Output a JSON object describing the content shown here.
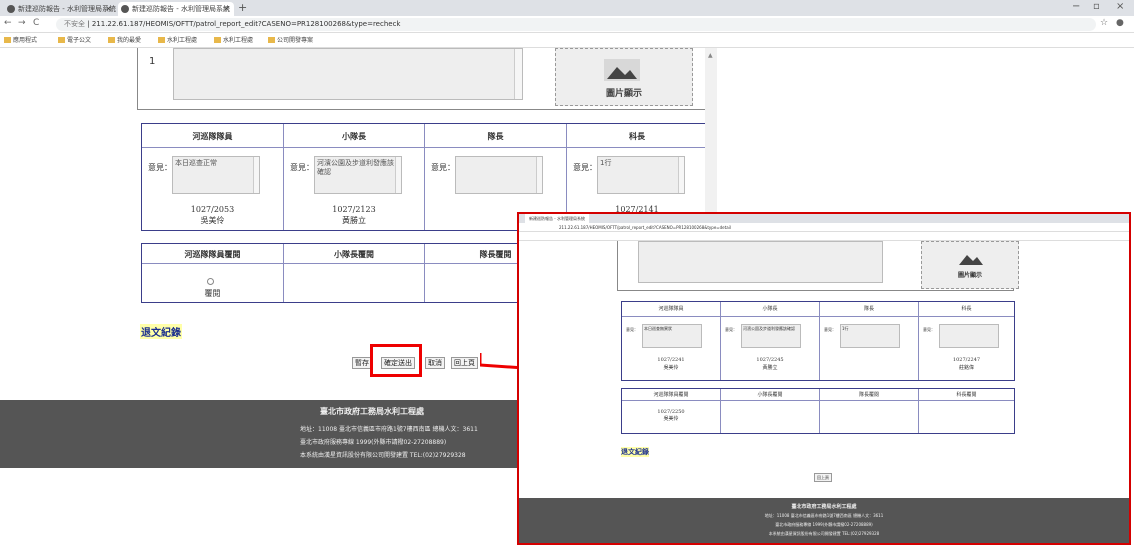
{
  "browser": {
    "tabs": [
      {
        "label": "新建巡防報告 - 水利管理局系統"
      },
      {
        "label": "新建巡防報告 - 水利管理局系統"
      }
    ],
    "new_tab": "+",
    "minimize": "−",
    "maximize": "▫",
    "close": "×",
    "security": "不安全",
    "url": "211.22.61.187/HEOMIS/OFTT/patrol_report_edit?CASENO=PR128100268&type=recheck",
    "bookmarks": [
      {
        "label": "應用程式"
      },
      {
        "label": "電子公文"
      },
      {
        "label": "我的最愛"
      },
      {
        "label": "水利工程處"
      },
      {
        "label": "水利工程處"
      },
      {
        "label": "公司開發專案"
      }
    ]
  },
  "report": {
    "row_number": "1",
    "image_label": "圖片顯示",
    "sign_table": {
      "columns": [
        {
          "header": "河巡隊隊員",
          "opinion_label": "意見：",
          "opinion": "本日巡查正常",
          "date": "1027/2053",
          "name": "吳美伶"
        },
        {
          "header": "小隊長",
          "opinion_label": "意見：",
          "opinion": "河濱公園及步道利發應該確認",
          "date": "1027/2123",
          "name": "黃勝立"
        },
        {
          "header": "隊長",
          "opinion_label": "意見：",
          "opinion": "",
          "date": "",
          "name": ""
        },
        {
          "header": "科長",
          "opinion_label": "意見：",
          "opinion": "1行",
          "date": "1027/2141",
          "name": ""
        }
      ]
    },
    "review_table": {
      "columns": [
        {
          "header": "河巡隊隊員覆閱",
          "label": "覆閱"
        },
        {
          "header": "小隊長覆閱",
          "label": ""
        },
        {
          "header": "隊長覆閱",
          "label": ""
        }
      ]
    },
    "retreat_record": "退文紀錄",
    "buttons": {
      "temp": "暫存",
      "confirm": "確定送出",
      "cancel": "取消",
      "back": "回上頁"
    },
    "footer": {
      "title": "臺北市政府工務局水利工程處",
      "line1": "地址：11008 臺北市信義區市府路1號7樓西南區  總機人文：3611",
      "line2": "臺北市政府服務專線 1999(外縣市請撥02-27208889)",
      "line3": "本系統由漢星資訊股份有限公司開發建置 TEL:(02)27929328"
    }
  },
  "inset": {
    "tab_label": "新建巡防報告 - 水利管理局系統",
    "url": "211.22.61.187/HEOMIS/OFTT/patrol_report_edit?CASENO=PR128100268&type=detail",
    "image_label": "圖片顯示",
    "sign_columns": [
      {
        "header": "河巡隊隊員",
        "opinion": "本日巡查無異狀",
        "date": "1027/2241",
        "name": "吳美伶"
      },
      {
        "header": "小隊長",
        "opinion": "河濱公園及步道利發應該確認",
        "date": "1027/2245",
        "name": "黃勝立"
      },
      {
        "header": "隊長",
        "opinion": "1行",
        "date": "",
        "name": ""
      },
      {
        "header": "科長",
        "opinion": "",
        "date": "1027/2247",
        "name": "莊銘偉"
      }
    ],
    "review_columns": [
      {
        "header": "河巡隊隊員覆閱",
        "date": "1027/2250",
        "name": "吳美伶"
      },
      {
        "header": "小隊長覆閱",
        "date": "",
        "name": ""
      },
      {
        "header": "隊長覆閱",
        "date": "",
        "name": ""
      },
      {
        "header": "科長覆閱",
        "date": "",
        "name": ""
      }
    ],
    "retreat_record": "退文紀錄",
    "back_button": "回上頁",
    "footer_title": "臺北市政府工務局水利工程處",
    "footer_line1": "地址：11008 臺北市信義區市府路1號7樓西南區 總機人文：3611",
    "footer_line2": "臺北市政府服務專線 1999(外縣市請撥02-27208889)",
    "footer_line3": "本系統由漢星資訊股份有限公司開發建置 TEL:(02)27929328"
  },
  "colors": {
    "highlight": "#e00000",
    "footer_bg": "#555555",
    "retreat_bg": "#ffffa8",
    "table_border": "#3b3e8a"
  }
}
